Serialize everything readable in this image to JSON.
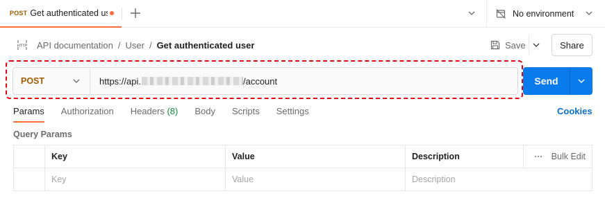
{
  "tab": {
    "method": "POST",
    "title": "Get authenticated user",
    "new_tab_symbol": "+",
    "unsaved_dot_color": "#ff6c37"
  },
  "environment": {
    "label": "No environment"
  },
  "breadcrumb": {
    "icon": "http-icon",
    "items": [
      "API documentation",
      "User"
    ],
    "current": "Get authenticated user",
    "separator": "/"
  },
  "actions": {
    "save_label": "Save",
    "share_label": "Share"
  },
  "request": {
    "method": "POST",
    "url_prefix": "https://api.",
    "url_suffix": "/account",
    "send_label": "Send",
    "method_color": "#a35b00",
    "send_color": "#097bed",
    "focus_outline_color": "#e6000f"
  },
  "request_tabs": [
    {
      "label": "Params",
      "count": "",
      "active": true
    },
    {
      "label": "Authorization",
      "count": "",
      "active": false
    },
    {
      "label": "Headers",
      "count": "(8)",
      "active": false
    },
    {
      "label": "Body",
      "count": "",
      "active": false
    },
    {
      "label": "Scripts",
      "count": "",
      "active": false
    },
    {
      "label": "Settings",
      "count": "",
      "active": false
    }
  ],
  "cookies_label": "Cookies",
  "query_params": {
    "title": "Query Params",
    "columns": [
      "Key",
      "Value",
      "Description"
    ],
    "bulk_edit_label": "Bulk Edit",
    "placeholders": {
      "key": "Key",
      "value": "Value",
      "description": "Description"
    }
  }
}
